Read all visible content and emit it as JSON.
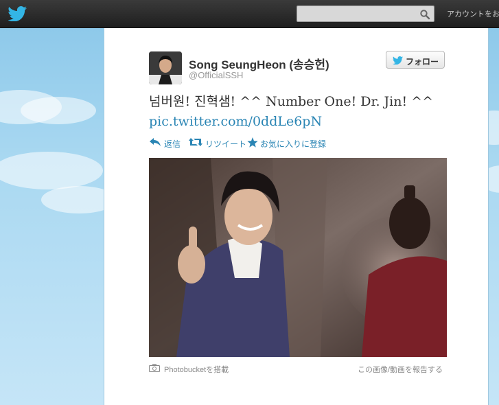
{
  "header": {
    "search_placeholder": "",
    "account_label": "アカウントをお持ち"
  },
  "tweet": {
    "author_name": "Song SeungHeon (송승헌)",
    "handle": "@OfficialSSH",
    "follow_label": "フォロー",
    "text": "넘버원! 진혁샘! ^^ Number One! Dr. Jin! ^^",
    "link": "pic.twitter.com/0ddLe6pN",
    "actions": {
      "reply": "返信",
      "retweet": "リツイート",
      "favorite": "お気に入りに登録"
    },
    "photo_source": "Photobucketを搭載",
    "report": "この画像/動画を報告する"
  },
  "colors": {
    "link": "#2a85b4",
    "topbar": "#2a2a2a",
    "sky": "#c0deed"
  },
  "icons": [
    "twitter-bird-icon",
    "search-icon",
    "reply-icon",
    "retweet-icon",
    "star-icon",
    "camera-icon"
  ]
}
